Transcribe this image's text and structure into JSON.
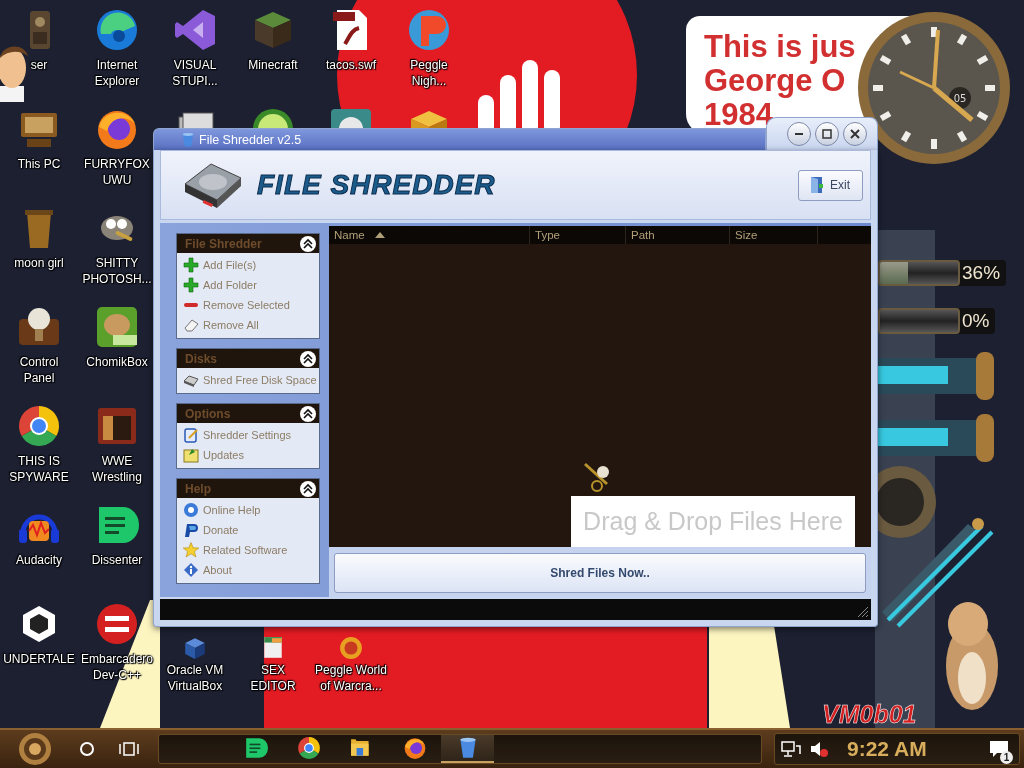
{
  "desktop": {
    "columns": [
      {
        "top": [
          {
            "kind": "shortcut",
            "label": "ser"
          },
          {
            "kind": "shortcut",
            "label": "This PC"
          },
          {
            "kind": "shortcut",
            "label": "moon girl"
          },
          {
            "kind": "shortcut",
            "label": "Control Panel"
          },
          {
            "kind": "shortcut",
            "label": "THIS IS SPYWARE"
          },
          {
            "kind": "shortcut",
            "label": "Audacity"
          },
          {
            "kind": "shortcut",
            "label": "UNDERTALE"
          }
        ]
      },
      {
        "top": [
          {
            "kind": "shortcut",
            "label": "Internet Explorer"
          },
          {
            "kind": "shortcut",
            "label": "FURRYFOX UWU"
          },
          {
            "kind": "shortcut",
            "label": "SHITTY PHOTOSH..."
          },
          {
            "kind": "shortcut",
            "label": "ChomikBox"
          },
          {
            "kind": "shortcut",
            "label": "WWE Wrestling"
          },
          {
            "kind": "shortcut",
            "label": "Dissenter"
          },
          {
            "kind": "shortcut",
            "label": "Embarcadero Dev-C++"
          }
        ]
      },
      {
        "top": [
          {
            "kind": "shortcut",
            "label": "VISUAL STUPI..."
          },
          {
            "kind": "partial"
          }
        ],
        "bottom": [
          {
            "kind": "shortcut",
            "label": "Oracle VM VirtualBox"
          }
        ]
      },
      {
        "top": [
          {
            "kind": "shortcut",
            "label": "Minecraft"
          },
          {
            "kind": "partial"
          }
        ],
        "bottom": [
          {
            "kind": "shortcut",
            "label": "SEX EDITOR"
          }
        ]
      },
      {
        "top": [
          {
            "kind": "shortcut",
            "label": "tacos.swf"
          },
          {
            "kind": "partial"
          }
        ],
        "bottom": [
          {
            "kind": "shortcut",
            "label": "Peggle World of Warcra..."
          }
        ]
      },
      {
        "top": [
          {
            "kind": "shortcut",
            "label": "Peggle Nigh..."
          },
          {
            "kind": "partial"
          }
        ]
      }
    ]
  },
  "note": {
    "lines": [
      "This is jus",
      "George O",
      "1984"
    ]
  },
  "clock": {
    "date": "05"
  },
  "gauges": [
    {
      "reading": "36%",
      "level": 0.36
    },
    {
      "reading": "0%",
      "level": 0
    }
  ],
  "signature": "VM0b01",
  "window": {
    "title": "File Shredder v2.5",
    "app_name": "FILE SHREDDER",
    "exit_button": "Exit",
    "sections": [
      {
        "title": "File Shredder",
        "expanded": true,
        "items": [
          "Add File(s)",
          "Add Folder",
          "Remove Selected",
          "Remove All"
        ]
      },
      {
        "title": "Disks",
        "expanded": true,
        "items": [
          "Shred Free Disk Space"
        ]
      },
      {
        "title": "Options",
        "expanded": true,
        "items": [
          "Shredder Settings",
          "Updates"
        ]
      },
      {
        "title": "Help",
        "expanded": true,
        "items": [
          "Online Help",
          "Donate",
          "Related Software",
          "About"
        ]
      }
    ],
    "table": {
      "columns": [
        {
          "label": "Name",
          "sorted": true
        },
        {
          "label": "Type",
          "sorted": false
        },
        {
          "label": "Path",
          "sorted": false
        },
        {
          "label": "Size",
          "sorted": false
        }
      ]
    },
    "drop_hint": "Drag & Drop Files Here",
    "shred_button": "Shred Files Now.."
  },
  "taskbar": {
    "apps": [
      {
        "selected": false
      },
      {
        "selected": false
      },
      {
        "selected": false
      },
      {
        "selected": false
      },
      {
        "selected": true
      }
    ],
    "clock": "9:22 AM",
    "notification_count": "1"
  }
}
